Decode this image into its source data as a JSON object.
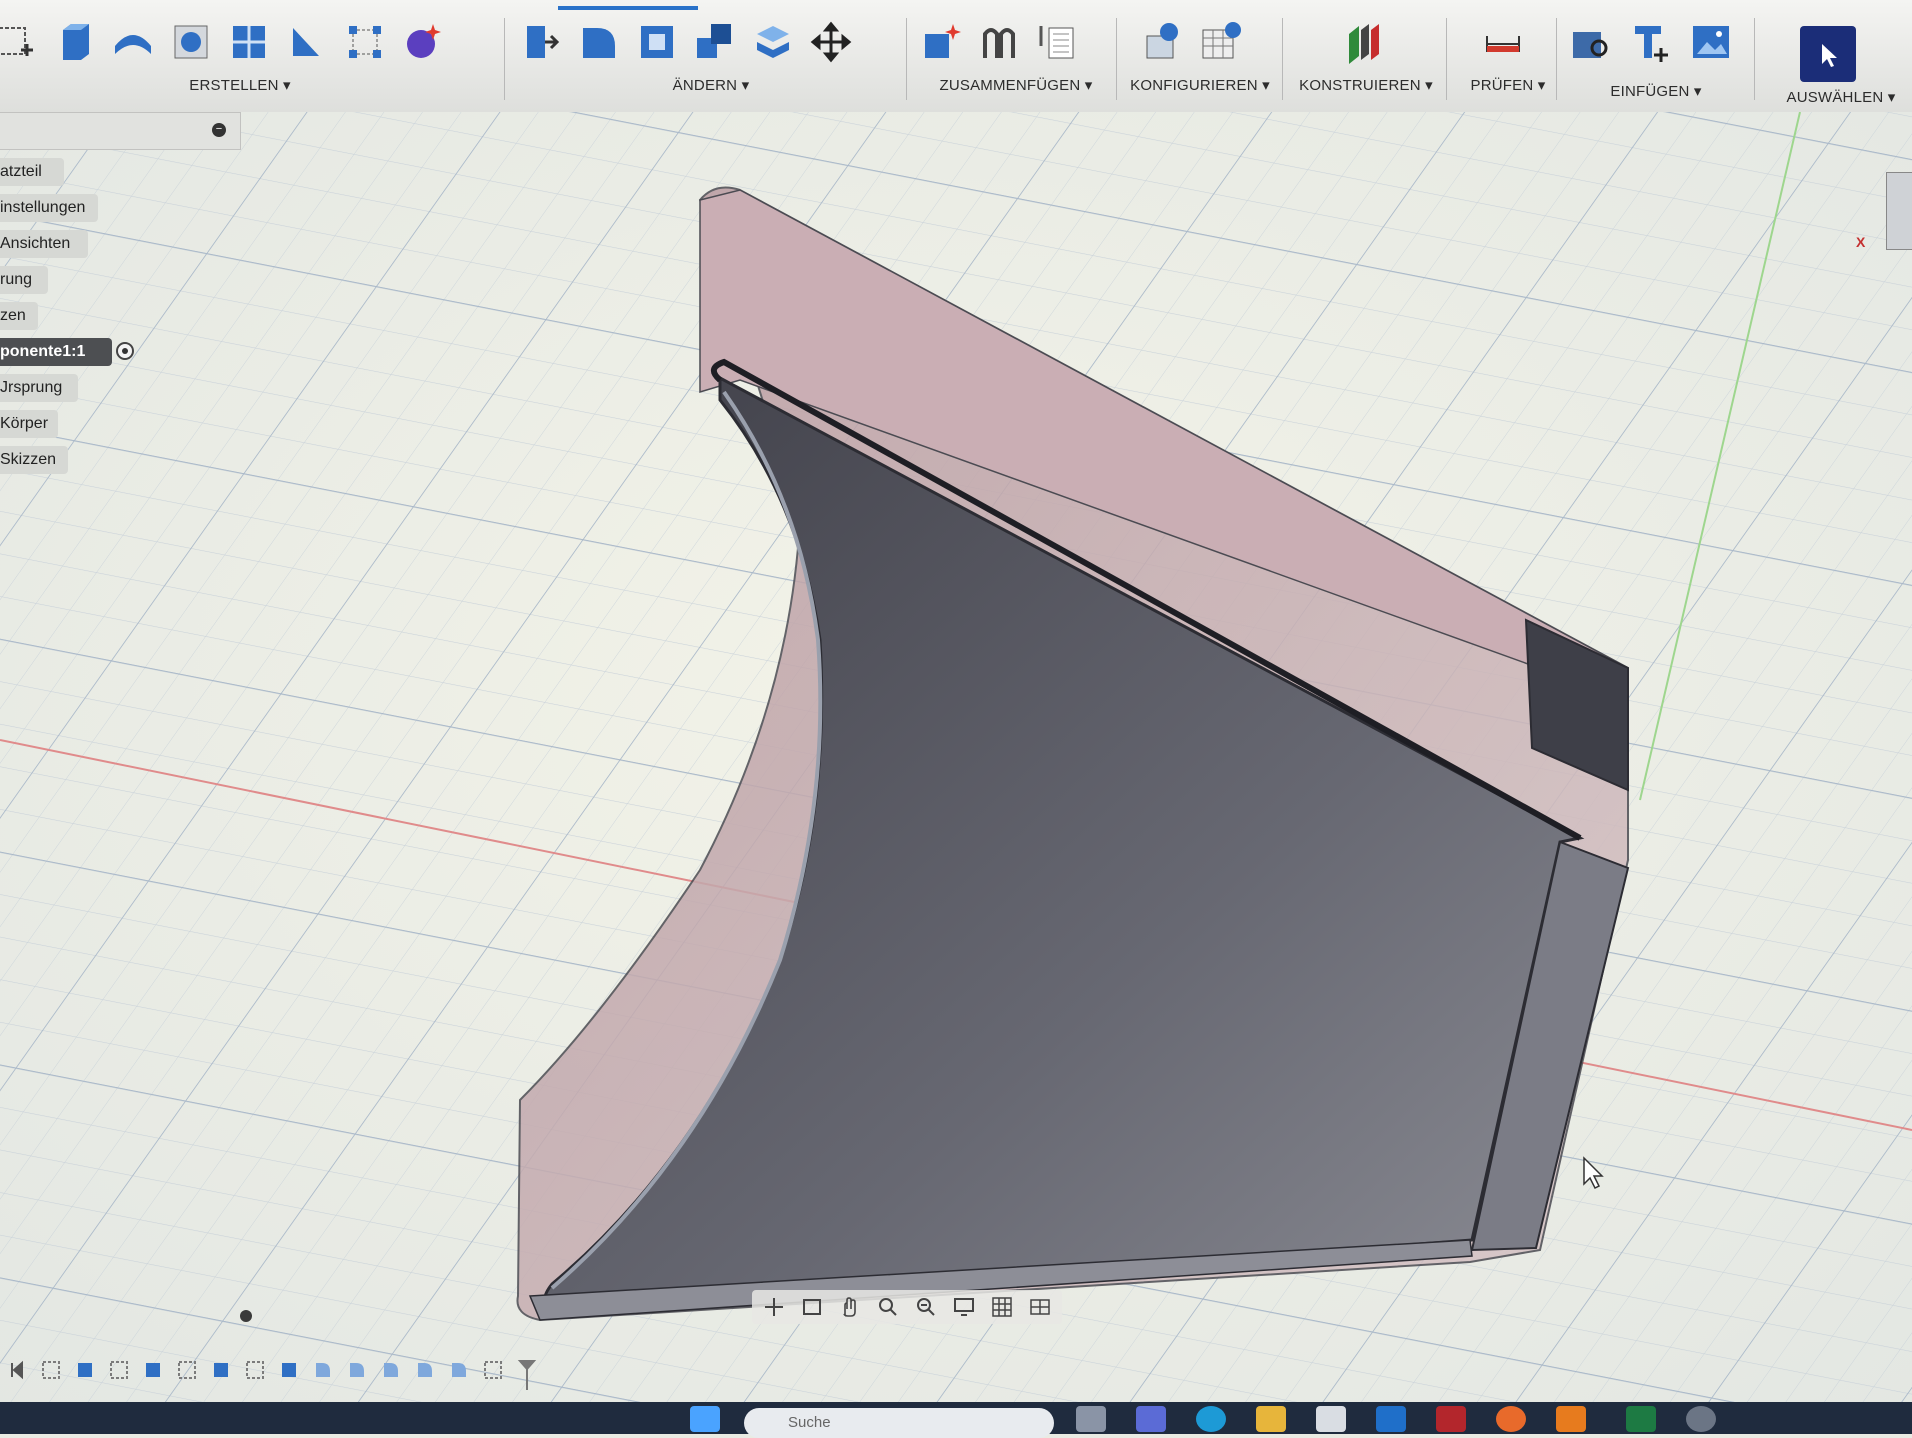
{
  "toolbar": {
    "groups": [
      {
        "label": "ERSTELLEN ▾"
      },
      {
        "label": "ÄNDERN ▾"
      },
      {
        "label": "ZUSAMMENFÜGEN ▾"
      },
      {
        "label": "KONFIGURIEREN ▾"
      },
      {
        "label": "KONSTRUIEREN ▾"
      },
      {
        "label": "PRÜFEN ▾"
      },
      {
        "label": "EINFÜGEN ▾"
      },
      {
        "label": "AUSWÄHLEN ▾"
      }
    ]
  },
  "browser": {
    "items": [
      {
        "label": "atzteil"
      },
      {
        "label": "instellungen"
      },
      {
        "label": "Ansichten"
      },
      {
        "label": "rung"
      },
      {
        "label": "zen"
      },
      {
        "label": "ponente1:1"
      },
      {
        "label": "Jrsprung"
      },
      {
        "label": "Körper"
      },
      {
        "label": "Skizzen"
      }
    ]
  },
  "viewcube": {
    "axis_label": "X"
  },
  "taskbar": {
    "search_placeholder": "Suche"
  },
  "colors": {
    "accent": "#2a72c9",
    "grid_major": "#9fb0c4",
    "grid_minor": "#c6cfd8",
    "body_outer": "#c9b1b6",
    "body_inner": "#55565f"
  }
}
